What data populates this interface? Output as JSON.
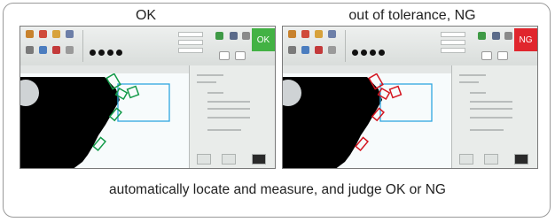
{
  "labels": {
    "ok": "OK",
    "ng": "out of tolerance, NG"
  },
  "caption": "automatically locate and measure, and judge OK or NG",
  "panels": {
    "ok": {
      "status": "OK",
      "status_color": "#43b244",
      "marker_color": "#139a49"
    },
    "ng": {
      "status": "NG",
      "status_color": "#e0262d",
      "marker_color": "#d4141f"
    }
  },
  "colors": {
    "roi_box": "#2fa6e0",
    "workpiece": "#000000",
    "background": "#f7fbfc"
  },
  "icons": [
    "app-icon",
    "person-icon",
    "folder-icon",
    "save-icon",
    "gear-icon",
    "camera-icon",
    "chart-icon",
    "wrench-icon"
  ]
}
